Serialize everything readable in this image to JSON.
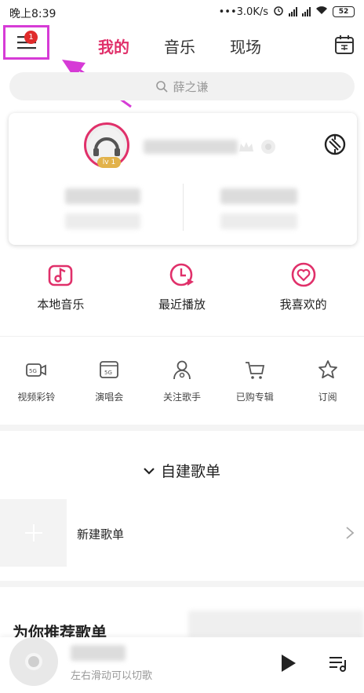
{
  "status_bar": {
    "time": "晚上8:39",
    "speed": "3.0K/s",
    "battery": "52"
  },
  "header": {
    "badge_count": "1",
    "tabs": [
      {
        "label": "我的",
        "active": true
      },
      {
        "label": "音乐",
        "active": false
      },
      {
        "label": "现场",
        "active": false
      }
    ]
  },
  "search": {
    "placeholder": "薛之谦"
  },
  "profile": {
    "level": "lv 1"
  },
  "main_actions": [
    {
      "label": "本地音乐",
      "icon": "local-music-icon"
    },
    {
      "label": "最近播放",
      "icon": "recent-play-icon"
    },
    {
      "label": "我喜欢的",
      "icon": "favorite-icon"
    }
  ],
  "secondary_actions": [
    {
      "label": "视频彩铃",
      "icon": "video-ringtone-icon"
    },
    {
      "label": "演唱会",
      "icon": "concert-icon"
    },
    {
      "label": "关注歌手",
      "icon": "followed-singer-icon"
    },
    {
      "label": "已购专辑",
      "icon": "cart-icon"
    },
    {
      "label": "订阅",
      "icon": "star-icon"
    }
  ],
  "playlists": {
    "header": "自建歌单",
    "new_playlist_label": "新建歌单"
  },
  "recommended": {
    "title": "为你推荐歌单"
  },
  "player": {
    "hint": "左右滑动可以切歌"
  },
  "colors": {
    "accent": "#e0306a",
    "highlight_box": "#d63bd6"
  }
}
